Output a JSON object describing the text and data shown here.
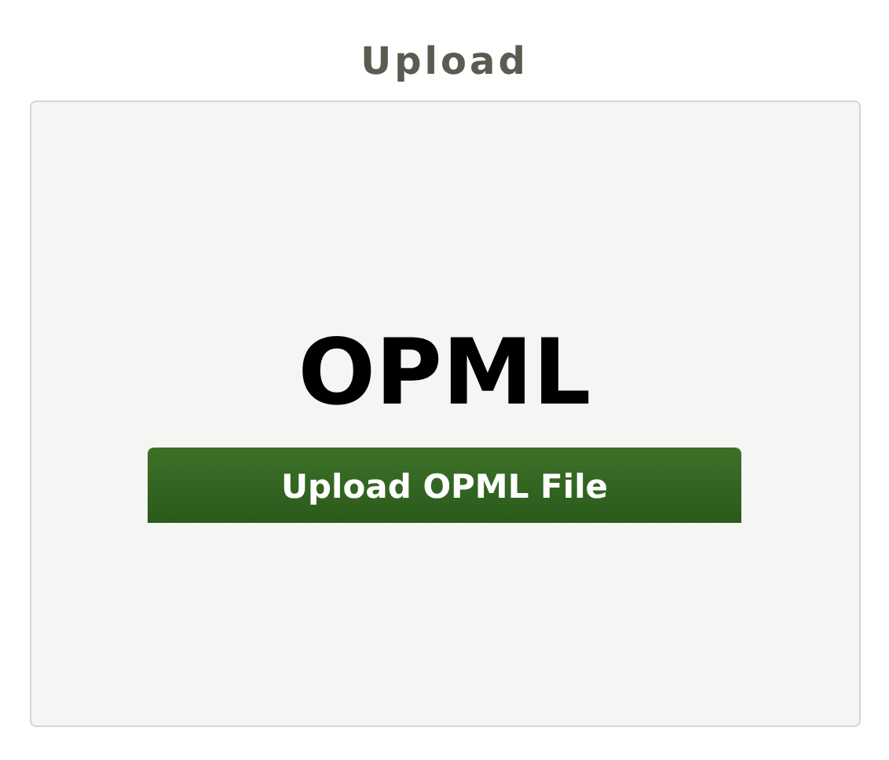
{
  "heading": "Upload",
  "card": {
    "title": "OPML",
    "button": "Upload OPML File"
  }
}
